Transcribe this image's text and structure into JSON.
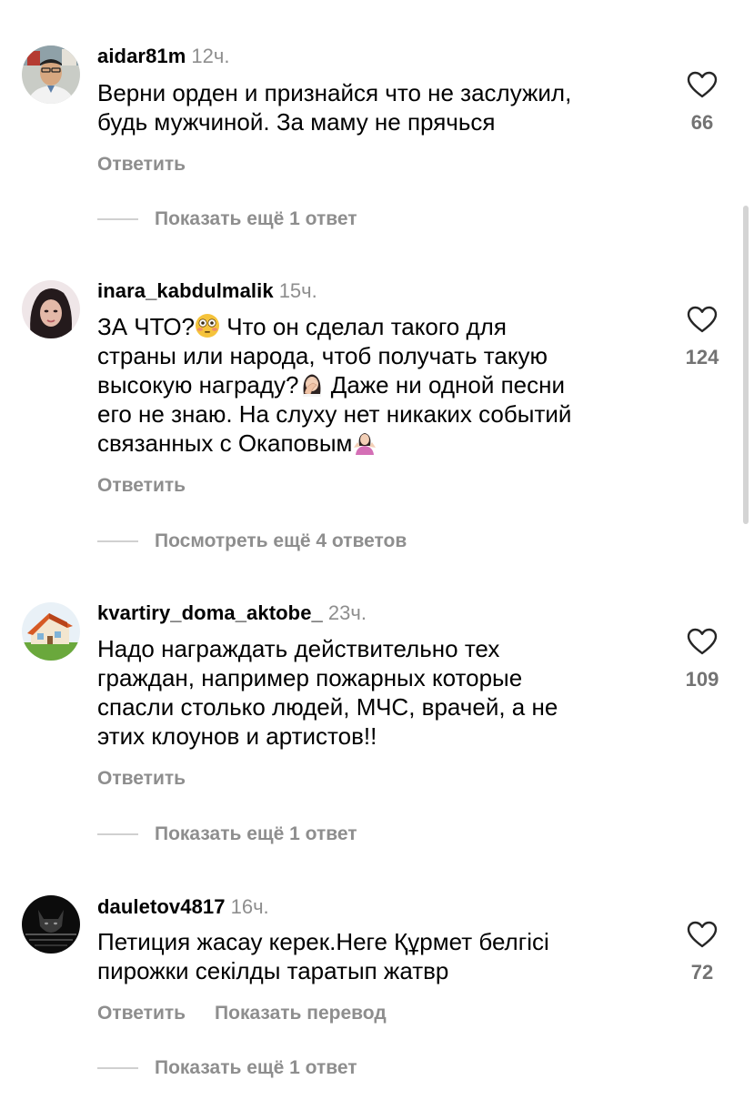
{
  "comments": [
    {
      "username": "aidar81m",
      "time": "12ч.",
      "text": "Верни орден и признайся что не заслужил,\nбудь мужчиной. За маму не прячься",
      "likes": "66",
      "reply_label": "Ответить",
      "more_replies": "Показать ещё 1 ответ"
    },
    {
      "username": "inara_kabdulmalik",
      "time": "15ч.",
      "text_parts": [
        "ЗА ЧТО?",
        " Что он сделал такого для\nстраны или народа, чтоб получать такую\nвысокую награду?",
        " Даже ни одной песни\nего не знаю. На слуху нет никаких событий\nсвязанных с Окаповым"
      ],
      "likes": "124",
      "reply_label": "Ответить",
      "more_replies": "Посмотреть ещё 4 ответов"
    },
    {
      "username": "kvartiry_doma_aktobe_",
      "time": "23ч.",
      "text": "Надо награждать действительно тех\nграждан, например пожарных которые\nспасли столько людей, МЧС, врачей, а не\nэтих клоунов и артистов!!",
      "likes": "109",
      "reply_label": "Ответить",
      "more_replies": "Показать ещё 1 ответ"
    },
    {
      "username": "dauletov4817",
      "time": "16ч.",
      "text": "Петиция жасау керек.Неге Құрмет белгісі\nпирожки секілды таратып жатвр",
      "likes": "72",
      "reply_label": "Ответить",
      "translate_label": "Показать перевод",
      "more_replies": "Показать ещё 1 ответ"
    }
  ],
  "icons": {
    "like": "heart-outline-icon",
    "flushed_emoji": "flushed-face-emoji",
    "facepalm_emoji": "woman-facepalming-emoji",
    "shrug_emoji": "woman-shrugging-emoji"
  },
  "colors": {
    "secondary_text": "#8e8e8e",
    "divider": "#d0d0d0"
  }
}
